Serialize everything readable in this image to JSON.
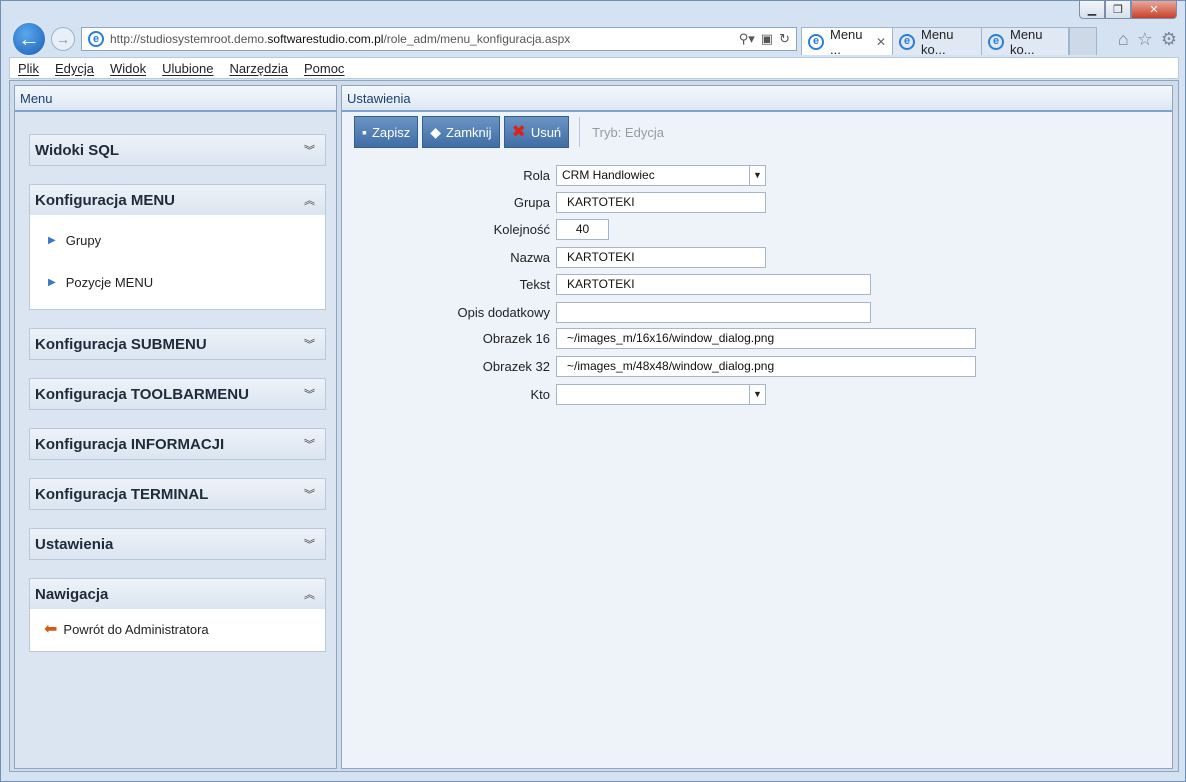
{
  "browser": {
    "url_prefix": "http://studiosystemroot.demo.",
    "url_host": "softwarestudio.com.pl",
    "url_path": "/role_adm/menu_konfiguracja.aspx",
    "tabs": [
      {
        "label": "Menu ...",
        "active": true
      },
      {
        "label": "Menu ko...",
        "active": false
      },
      {
        "label": "Menu ko...",
        "active": false
      }
    ]
  },
  "menubar": [
    "Plik",
    "Edycja",
    "Widok",
    "Ulubione",
    "Narzędzia",
    "Pomoc"
  ],
  "left_panel": {
    "title": "Menu",
    "sections": [
      {
        "title": "Widoki SQL",
        "expanded": false,
        "items": []
      },
      {
        "title": "Konfiguracja MENU",
        "expanded": true,
        "items": [
          "Grupy",
          "Pozycje MENU"
        ]
      },
      {
        "title": "Konfiguracja SUBMENU",
        "expanded": false,
        "items": []
      },
      {
        "title": "Konfiguracja TOOLBARMENU",
        "expanded": false,
        "items": []
      },
      {
        "title": "Konfiguracja INFORMACJI",
        "expanded": false,
        "items": []
      },
      {
        "title": "Konfiguracja TERMINAL",
        "expanded": false,
        "items": []
      },
      {
        "title": "Ustawienia",
        "expanded": false,
        "items": []
      },
      {
        "title": "Nawigacja",
        "expanded": true,
        "items": [
          "Powrót do Administratora"
        ]
      }
    ]
  },
  "right_panel": {
    "title": "Ustawienia",
    "toolbar": {
      "save": "Zapisz",
      "close": "Zamknij",
      "delete": "Usuń",
      "mode": "Tryb: Edycja"
    },
    "form": {
      "rola": {
        "label": "Rola",
        "value": "CRM Handlowiec"
      },
      "grupa": {
        "label": "Grupa",
        "value": "KARTOTEKI"
      },
      "kolejnosc": {
        "label": "Kolejność",
        "value": "40"
      },
      "nazwa": {
        "label": "Nazwa",
        "value": "KARTOTEKI"
      },
      "tekst": {
        "label": "Tekst",
        "value": "KARTOTEKI"
      },
      "opis": {
        "label": "Opis dodatkowy",
        "value": ""
      },
      "obrazek16": {
        "label": "Obrazek 16",
        "value": "~/images_m/16x16/window_dialog.png"
      },
      "obrazek32": {
        "label": "Obrazek 32",
        "value": "~/images_m/48x48/window_dialog.png"
      },
      "kto": {
        "label": "Kto",
        "value": ""
      }
    }
  }
}
